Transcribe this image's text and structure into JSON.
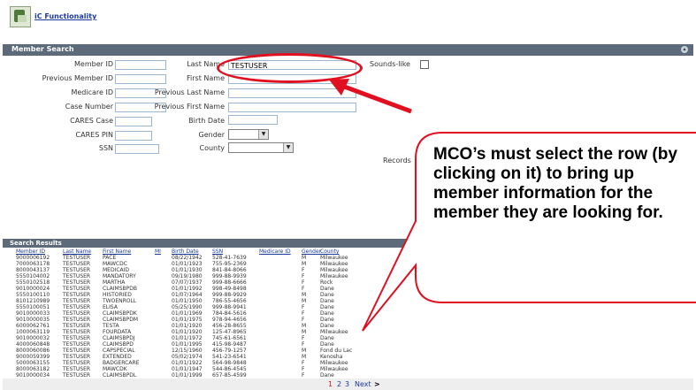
{
  "app": {
    "link_label": "iC Functionality"
  },
  "member_search": {
    "title": "Member Search",
    "labels": {
      "member_id": "Member ID",
      "previous_member_id": "Previous Member ID",
      "medicare_id": "Medicare ID",
      "case_number": "Case Number",
      "cares_case": "CARES Case",
      "cares_pin": "CARES PIN",
      "ssn": "SSN",
      "last_name": "Last Name",
      "first_name": "First Name",
      "previous_last_name": "Previous Last Name",
      "previous_first_name": "Previous First Name",
      "birth_date": "Birth Date",
      "gender": "Gender",
      "county": "County",
      "sounds_like": "Sounds-like",
      "records": "Records"
    },
    "values": {
      "last_name": "TESTUSER"
    }
  },
  "results": {
    "title": "Search Results",
    "columns": [
      "Member ID",
      "Last Name",
      "First Name",
      "MI",
      "Birth Date",
      "SSN",
      "Medicare ID",
      "Gender",
      "County"
    ],
    "rows": [
      [
        "9000006192",
        "TESTUSER",
        "PACE",
        "",
        "08/22/1942",
        "528-41-7639",
        "",
        "M",
        "Milwaukee"
      ],
      [
        "7000063178",
        "TESTUSER",
        "MAWCDC",
        "",
        "01/01/1923",
        "755-95-2369",
        "",
        "M",
        "Milwaukee"
      ],
      [
        "8000043137",
        "TESTUSER",
        "MEDICAID",
        "",
        "01/01/1930",
        "841-84-8066",
        "",
        "F",
        "Milwaukee"
      ],
      [
        "5550104002",
        "TESTUSER",
        "MANDATORY",
        "",
        "09/19/1980",
        "999-88-9939",
        "",
        "F",
        "Milwaukee"
      ],
      [
        "5550102518",
        "TESTUSER",
        "MARTHA",
        "",
        "07/07/1937",
        "999-88-6666",
        "",
        "F",
        "Rock"
      ],
      [
        "9010000024",
        "TESTUSER",
        "CLAIMSBPDB",
        "",
        "01/01/1992",
        "998-49-8498",
        "",
        "F",
        "Dane"
      ],
      [
        "5550100110",
        "TESTUSER",
        "HISTORIED",
        "",
        "01/07/1964",
        "999-88-9929",
        "",
        "M",
        "Dane"
      ],
      [
        "8101210989",
        "TESTUSER",
        "TWOENROLL",
        "",
        "01/01/1950",
        "786-55-4656",
        "",
        "M",
        "Dane"
      ],
      [
        "5550100051",
        "TESTUSER",
        "ELISA",
        "",
        "05/25/1990",
        "999-88-9941",
        "",
        "F",
        "Dane"
      ],
      [
        "9010000033",
        "TESTUSER",
        "CLAIMSBPDK",
        "",
        "01/01/1969",
        "784-84-5616",
        "",
        "F",
        "Dane"
      ],
      [
        "9010000035",
        "TESTUSER",
        "CLAIMSBPDM",
        "",
        "01/01/1975",
        "978-94-4656",
        "",
        "F",
        "Dane"
      ],
      [
        "6000062761",
        "TESTUSER",
        "TESTA",
        "",
        "01/01/1920",
        "456-28-8655",
        "",
        "M",
        "Dane"
      ],
      [
        "1000063119",
        "TESTUSER",
        "FOURDATA",
        "",
        "01/01/1920",
        "125-47-8965",
        "",
        "M",
        "Milwaukee"
      ],
      [
        "9010000032",
        "TESTUSER",
        "CLAIMSBPDJ",
        "",
        "01/01/1972",
        "745-61-6561",
        "",
        "F",
        "Dane"
      ],
      [
        "4000060848",
        "TESTUSER",
        "CLAIMSBPD",
        "",
        "01/01/1995",
        "415-98-9487",
        "",
        "F",
        "Dane"
      ],
      [
        "8000060086",
        "TESTUSER",
        "CAPSPECIAL",
        "",
        "12/15/1960",
        "456-79-1257",
        "",
        "M",
        "Fond du Lac"
      ],
      [
        "9000059399",
        "TESTUSER",
        "EXTENDED",
        "",
        "05/02/1974",
        "541-23-6541",
        "",
        "M",
        "Kenosha"
      ],
      [
        "5000063155",
        "TESTUSER",
        "BADGERCARE",
        "",
        "01/01/1922",
        "564-98-9848",
        "",
        "F",
        "Milwaukee"
      ],
      [
        "8000063182",
        "TESTUSER",
        "MAWCDK",
        "",
        "01/01/1947",
        "544-86-4545",
        "",
        "F",
        "Milwaukee"
      ],
      [
        "9010000034",
        "TESTUSER",
        "CLAIMSBPDL",
        "",
        "01/01/1999",
        "657-85-4599",
        "",
        "F",
        "Dane"
      ]
    ]
  },
  "pagination": {
    "current": "1",
    "pages": [
      "2",
      "3"
    ],
    "next_label": "Next",
    "next_arrow": ">"
  },
  "annotation": {
    "callout_text": "MCO’s must select the row (by clicking on it) to bring up member information for the member they are looking for.",
    "accent_color": "#e01020"
  }
}
